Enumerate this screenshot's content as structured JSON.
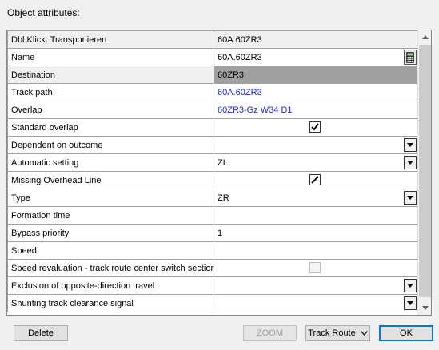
{
  "dialog": {
    "title": "Object attributes:"
  },
  "grid": {
    "header": {
      "label": "Dbl Klick: Transponieren",
      "value": "60A.60ZR3"
    },
    "rows": [
      {
        "label": "Name",
        "value": "60A.60ZR3"
      },
      {
        "label": "Destination",
        "value": "60ZR3"
      },
      {
        "label": "Track path",
        "value": "60A.60ZR3"
      },
      {
        "label": "Overlap",
        "value": "60ZR3-Gz W34 D1"
      },
      {
        "label": "Standard overlap",
        "value": ""
      },
      {
        "label": "Dependent on outcome",
        "value": ""
      },
      {
        "label": "Automatic setting",
        "value": "ZL"
      },
      {
        "label": "Missing Overhead Line",
        "value": ""
      },
      {
        "label": "Type",
        "value": "ZR"
      },
      {
        "label": "Formation time",
        "value": ""
      },
      {
        "label": "Bypass priority",
        "value": "1"
      },
      {
        "label": "Speed",
        "value": ""
      },
      {
        "label": "Speed revaluation - track route center switch section",
        "value": ""
      },
      {
        "label": "Exclusion of opposite-direction travel",
        "value": ""
      },
      {
        "label": "Shunting track clearance signal",
        "value": ""
      }
    ]
  },
  "buttons": {
    "delete": "Delete",
    "zoom": "ZOOM",
    "route_type": "Track Route",
    "ok": "OK"
  },
  "icons": {
    "calculator": "calculator-icon",
    "dropdown": "chevron-down-icon",
    "check": "checkmark-icon",
    "slash": "slash-check-icon"
  },
  "colors": {
    "selected_row": "#a0a0a0",
    "link_text": "#1c2ccc",
    "default_button_border": "#0078d7"
  }
}
